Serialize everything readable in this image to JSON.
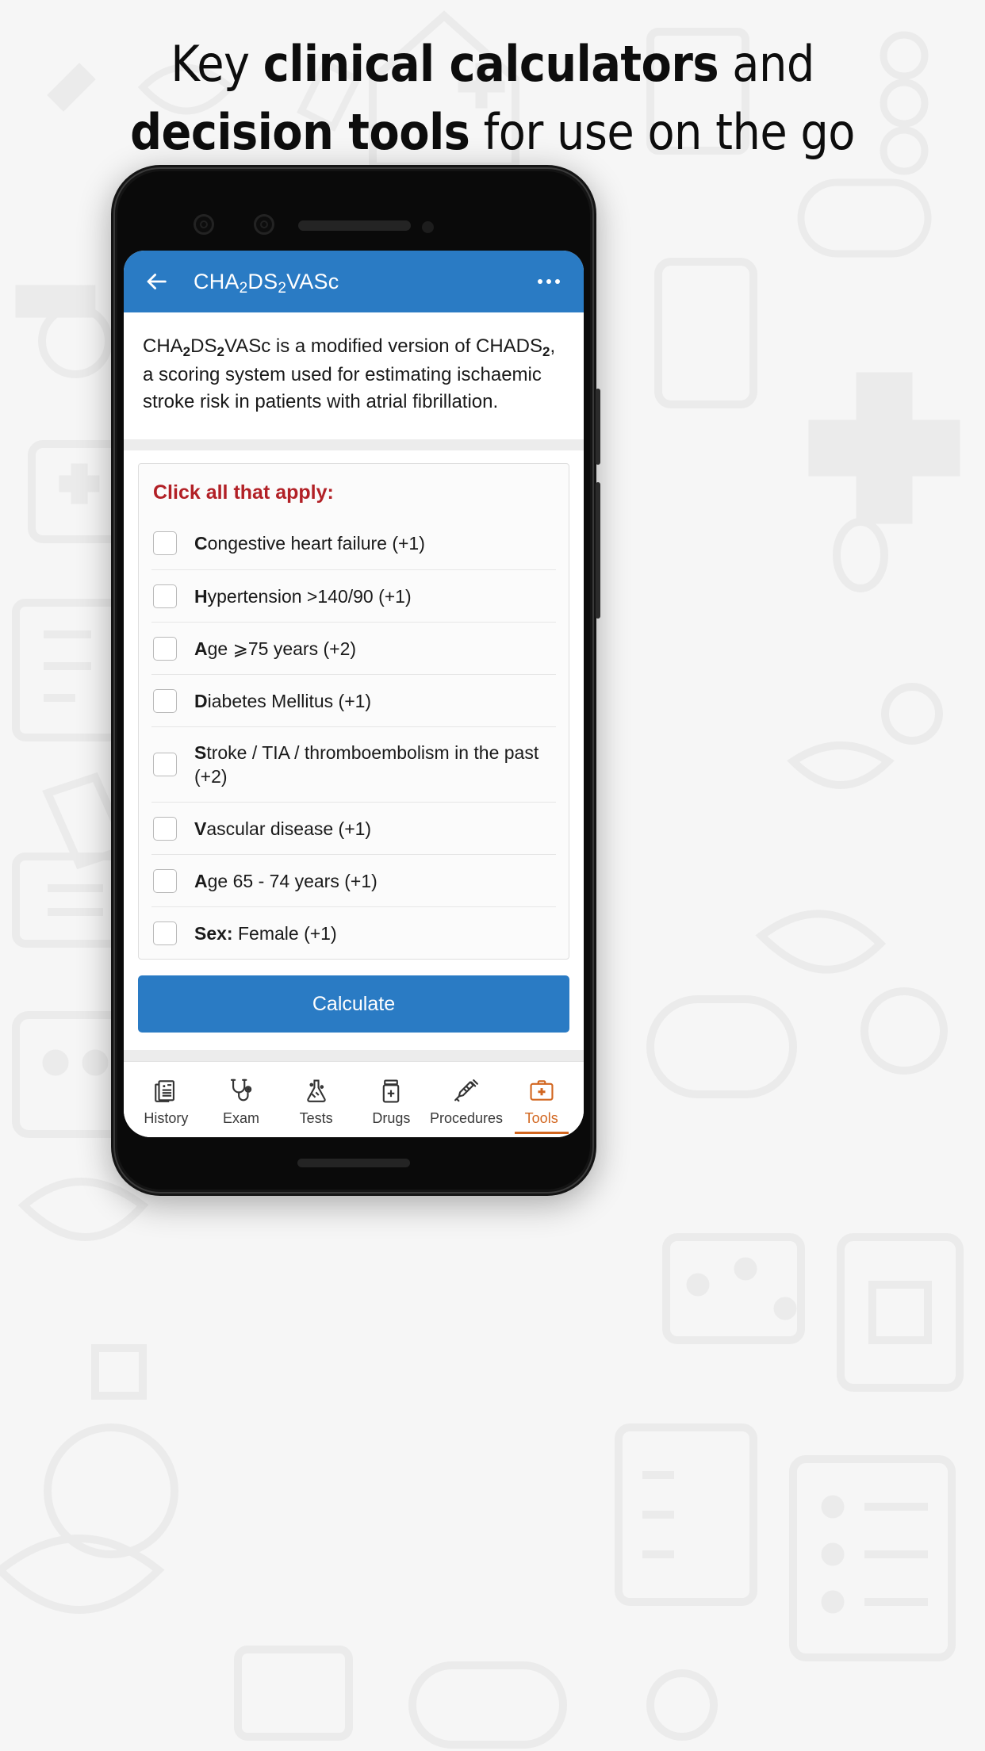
{
  "promo": {
    "headline_line1_plain_a": "Key ",
    "headline_line1_bold": "clinical calculators",
    "headline_line1_plain_b": " and",
    "headline_line2_bold": "decision tools",
    "headline_line2_plain": " for use on the go"
  },
  "appbar": {
    "back_icon": "arrow-left-icon",
    "title_prefix": "CHA",
    "title_sub1": "2",
    "title_mid": "DS",
    "title_sub2": "2",
    "title_suffix": "VASc",
    "overflow_icon": "overflow-menu-icon",
    "background_color": "#2a7bc4",
    "title_color": "#ffffff"
  },
  "description": {
    "part1": "CHA",
    "sub1": "2",
    "part2": "DS",
    "sub2": "2",
    "part3": "VASc is a modified version of CHADS",
    "sub3": "2",
    "part4": ", a scoring system used for estimating ischaemic stroke risk in patients with atrial fibrillation."
  },
  "panel": {
    "title": "Click all that apply:",
    "title_color": "#b22026",
    "items": [
      {
        "mnemonic": "C",
        "rest": "ongestive heart failure (+1)",
        "points": "+1"
      },
      {
        "mnemonic": "H",
        "rest": "ypertension >140/90 (+1)",
        "points": "+1"
      },
      {
        "mnemonic": "A",
        "rest": "ge ⩾75 years (+2)",
        "points": "+2"
      },
      {
        "mnemonic": "D",
        "rest": "iabetes Mellitus (+1)",
        "points": "+1"
      },
      {
        "mnemonic": "S",
        "rest": "troke / TIA / thromboembolism in the past (+2)",
        "points": "+2"
      },
      {
        "mnemonic": "V",
        "rest": "ascular disease (+1)",
        "points": "+1"
      },
      {
        "mnemonic": "A",
        "rest": "ge 65 - 74 years (+1)",
        "points": "+1"
      },
      {
        "mnemonic": "Sex:",
        "rest": " Female (+1)",
        "points": "+1"
      }
    ]
  },
  "calculate_button": {
    "label": "Calculate",
    "color": "#2a7bc4"
  },
  "bottom_nav": {
    "active_color": "#d2661f",
    "items": [
      {
        "label": "History",
        "icon": "document-list-icon",
        "active": false
      },
      {
        "label": "Exam",
        "icon": "stethoscope-icon",
        "active": false
      },
      {
        "label": "Tests",
        "icon": "flask-icon",
        "active": false
      },
      {
        "label": "Drugs",
        "icon": "pill-bottle-icon",
        "active": false
      },
      {
        "label": "Procedures",
        "icon": "syringe-icon",
        "active": false
      },
      {
        "label": "Tools",
        "icon": "medical-kit-icon",
        "active": true
      }
    ]
  }
}
